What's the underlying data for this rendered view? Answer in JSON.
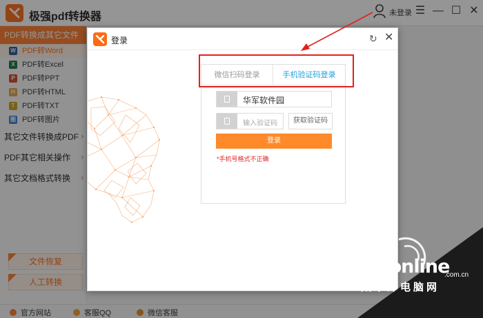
{
  "app": {
    "title": "极强pdf转换器",
    "login_status": "未登录",
    "accent": "#ff6a14"
  },
  "sidebar": {
    "section_header": "PDF转换成其它文件",
    "items": [
      {
        "label": "PDF转Word",
        "icon": "word-icon",
        "color": "#2b5797",
        "letter": "W"
      },
      {
        "label": "PDF转Excel",
        "icon": "excel-icon",
        "color": "#1e7145",
        "letter": "X"
      },
      {
        "label": "PDF转PPT",
        "icon": "ppt-icon",
        "color": "#d24726",
        "letter": "P"
      },
      {
        "label": "PDF转HTML",
        "icon": "html-icon",
        "color": "#e8a33d",
        "letter": "H"
      },
      {
        "label": "PDF转TXT",
        "icon": "txt-icon",
        "color": "#caa21a",
        "letter": "T"
      },
      {
        "label": "PDF转图片",
        "icon": "image-icon",
        "color": "#3b78d8",
        "letter": "图"
      }
    ],
    "groups": [
      {
        "label": "其它文件转换成PDF"
      },
      {
        "label": "PDF其它相关操作"
      },
      {
        "label": "其它文档格式转换"
      }
    ],
    "special": [
      {
        "label": "文件恢复"
      },
      {
        "label": "人工转换"
      }
    ]
  },
  "bottombar": {
    "items": [
      {
        "label": "官方网站",
        "icon": "home-icon"
      },
      {
        "label": "客服QQ",
        "icon": "qq-icon"
      },
      {
        "label": "微信客服",
        "icon": "wechat-icon"
      }
    ]
  },
  "modal": {
    "title": "登录",
    "tabs": [
      {
        "label": "微信扫码登录",
        "active": false
      },
      {
        "label": "手机验证码登录",
        "active": true
      }
    ],
    "phone_value": "华军软件园",
    "code_placeholder": "输入验证码",
    "get_code_label": "获取验证码",
    "login_button": "登录",
    "error_message": "*手机号格式不正确",
    "login_color": "#ff8a2a",
    "active_tab_color": "#1ba1e2"
  },
  "watermark": {
    "brand": "PConline",
    "suffix": ".com.cn",
    "chinese": "太平洋电脑网"
  }
}
